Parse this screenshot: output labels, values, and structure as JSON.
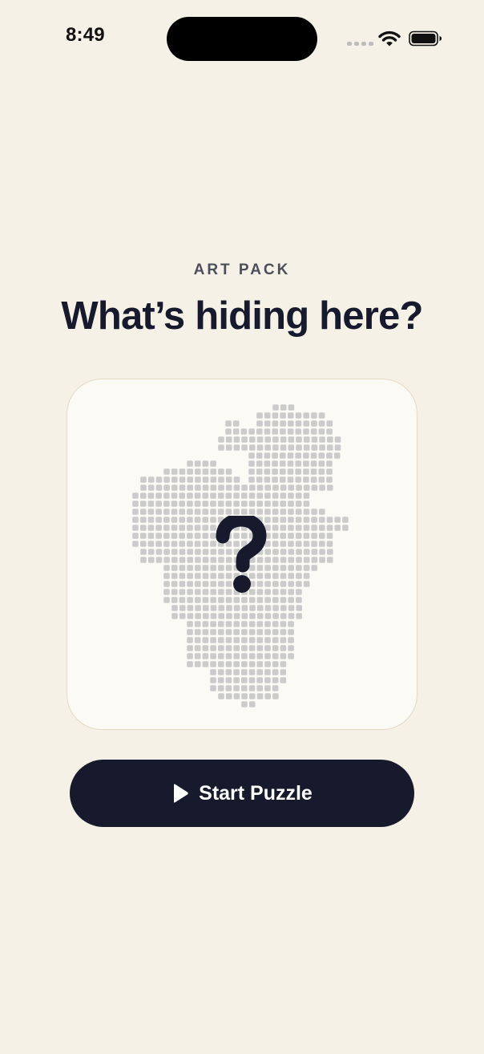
{
  "status_bar": {
    "time": "8:49",
    "icons": [
      "cellular-signal-icon",
      "wifi-icon",
      "battery-icon"
    ]
  },
  "header": {
    "eyebrow": "ART PACK",
    "title": "What’s hiding here?"
  },
  "puzzle_card": {
    "preview_icon": "question-mark-icon",
    "preview_state": "hidden"
  },
  "actions": {
    "start_label": "Start Puzzle",
    "start_icon": "play-icon"
  },
  "colors": {
    "background": "#F6F1E6",
    "ink": "#161A2C",
    "card": "#FCFAF5",
    "card_border": "#E4D8C2",
    "pixel": "#CBCBCB"
  }
}
